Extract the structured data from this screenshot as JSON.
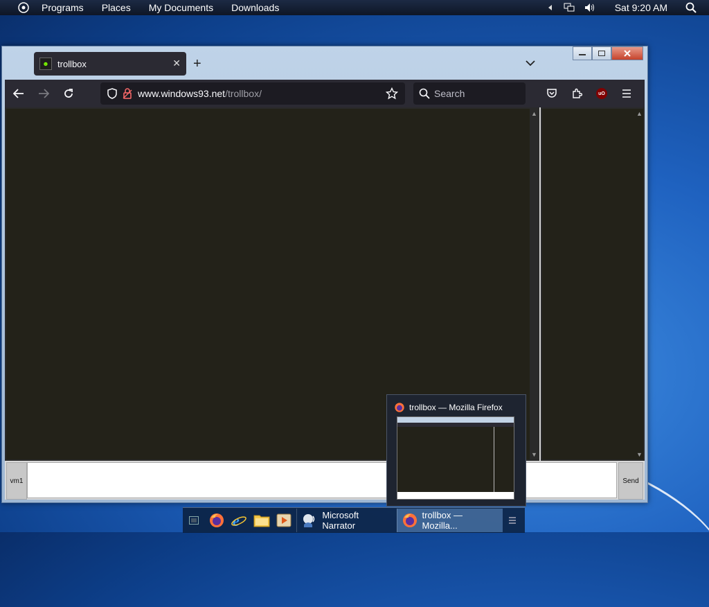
{
  "top_panel": {
    "menu": [
      "Programs",
      "Places",
      "My Documents",
      "Downloads"
    ],
    "clock": "Sat 9:20 AM",
    "icons": [
      "arrow-left-icon",
      "network-icon",
      "volume-icon",
      "search-icon"
    ]
  },
  "browser": {
    "tab_title": "trollbox",
    "new_tab_symbol": "+",
    "url_domain": "www.windows93.net",
    "url_path": "/trollbox/",
    "search_placeholder": "Search",
    "ublock_label": "uO"
  },
  "trollbox": {
    "nick_label": "vm1",
    "send_label": "Send"
  },
  "taskbar": {
    "tasks": [
      {
        "label": "Microsoft Narrator",
        "active": false
      },
      {
        "label": "trollbox — Mozilla...",
        "active": true
      }
    ]
  },
  "preview": {
    "title": "trollbox — Mozilla Firefox"
  },
  "colors": {
    "accent_firefox": "#ff7139",
    "browser_chrome": "#2b2a33",
    "chat_bg": "#232219"
  }
}
